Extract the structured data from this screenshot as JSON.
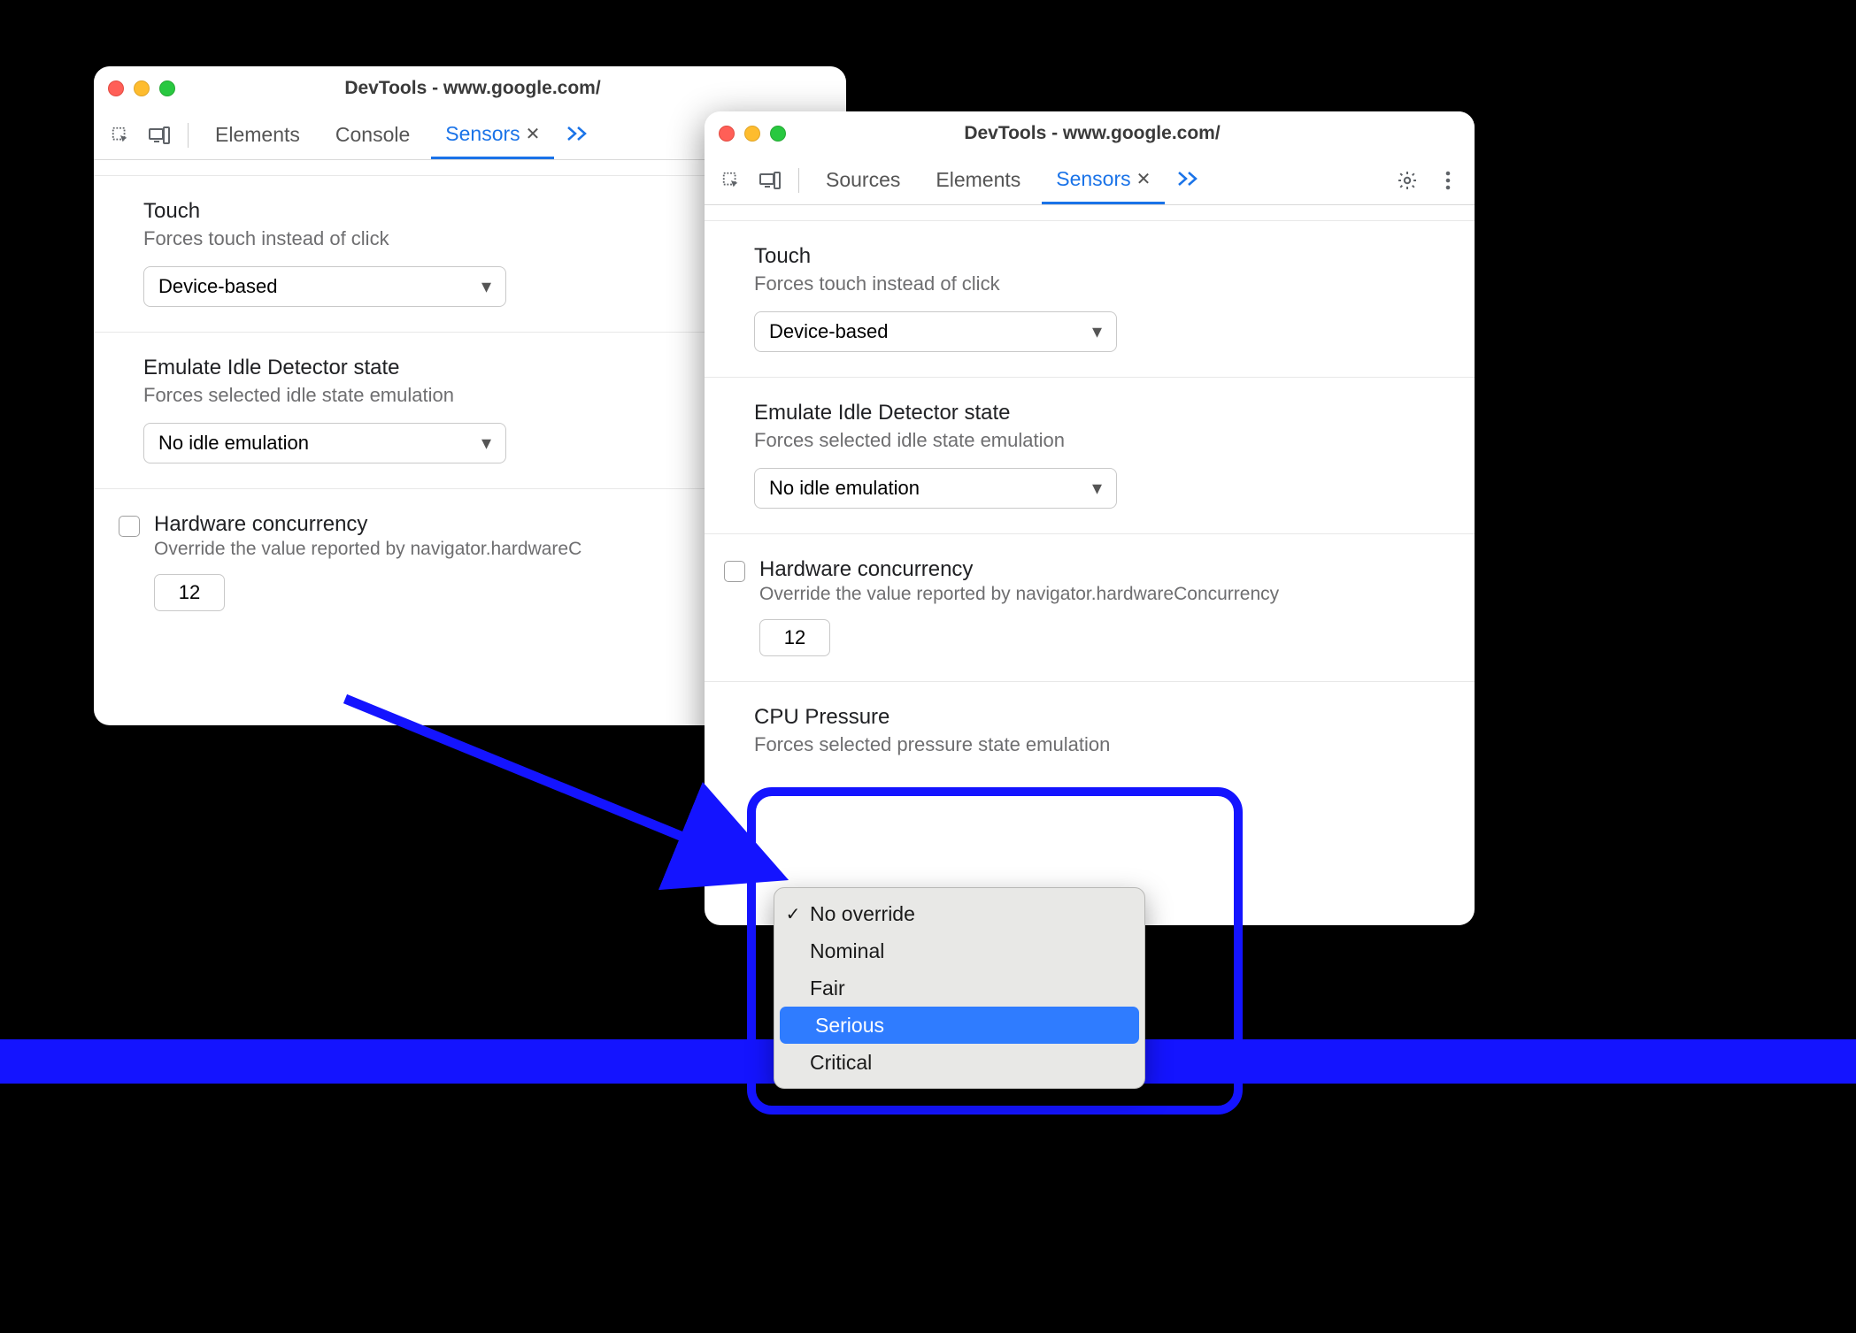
{
  "window1": {
    "title": "DevTools - www.google.com/",
    "tabs": {
      "elements": "Elements",
      "console": "Console",
      "sensors": "Sensors"
    },
    "touch": {
      "title": "Touch",
      "sub": "Forces touch instead of click",
      "value": "Device-based"
    },
    "idle": {
      "title": "Emulate Idle Detector state",
      "sub": "Forces selected idle state emulation",
      "value": "No idle emulation"
    },
    "hc": {
      "title": "Hardware concurrency",
      "sub": "Override the value reported by navigator.hardwareC",
      "value": "12"
    }
  },
  "window2": {
    "title": "DevTools - www.google.com/",
    "tabs": {
      "sources": "Sources",
      "elements": "Elements",
      "sensors": "Sensors"
    },
    "touch": {
      "title": "Touch",
      "sub": "Forces touch instead of click",
      "value": "Device-based"
    },
    "idle": {
      "title": "Emulate Idle Detector state",
      "sub": "Forces selected idle state emulation",
      "value": "No idle emulation"
    },
    "hc": {
      "title": "Hardware concurrency",
      "sub": "Override the value reported by navigator.hardwareConcurrency",
      "value": "12"
    },
    "cpu": {
      "title": "CPU Pressure",
      "sub": "Forces selected pressure state emulation"
    }
  },
  "dropdown": {
    "items": {
      "0": "No override",
      "1": "Nominal",
      "2": "Fair",
      "3": "Serious",
      "4": "Critical"
    },
    "selected_index": 0,
    "highlight_index": 3
  }
}
